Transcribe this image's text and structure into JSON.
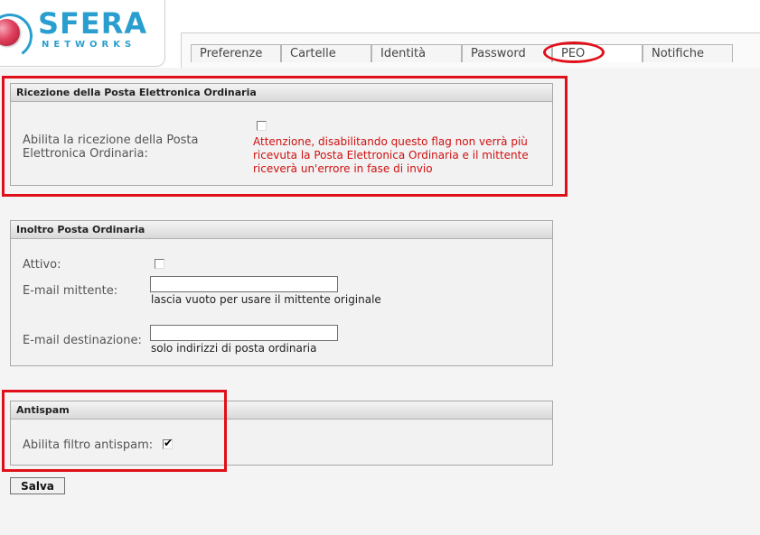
{
  "brand": {
    "name": "SFERA",
    "subtitle": "NETWORKS"
  },
  "tabs": [
    {
      "label": "Preferenze",
      "active": false
    },
    {
      "label": "Cartelle",
      "active": false
    },
    {
      "label": "Identità",
      "active": false
    },
    {
      "label": "Password",
      "active": false
    },
    {
      "label": "PEO",
      "active": true
    },
    {
      "label": "Notifiche",
      "active": false
    }
  ],
  "ricezione": {
    "legend": "Ricezione della Posta Elettronica Ordinaria",
    "label_line1": "Abilita la ricezione della Posta",
    "label_line2": "Elettronica Ordinaria:",
    "checked": false,
    "warning_line1": "Attenzione, disabilitando questo flag non verrà più",
    "warning_line2": "ricevuta la Posta Elettronica Ordinaria e il mittente",
    "warning_line3": "riceverà un'errore in fase di invio"
  },
  "inoltro": {
    "legend": "Inoltro Posta Ordinaria",
    "attivo_label": "Attivo:",
    "attivo_checked": false,
    "mittente_label": "E-mail mittente:",
    "mittente_value": "",
    "mittente_hint": "lascia vuoto per usare il mittente originale",
    "destinazione_label": "E-mail destinazione:",
    "destinazione_value": "",
    "destinazione_hint": "solo indirizzi di posta ordinaria"
  },
  "antispam": {
    "legend": "Antispam",
    "label": "Abilita filtro antispam:",
    "checked": true,
    "tick_glyph": "✔"
  },
  "save_label": "Salva",
  "colors": {
    "accent": "#2a9fcf",
    "logo_ball": "#e0435f",
    "warning": "#d01010",
    "highlight": "#e0101a"
  }
}
